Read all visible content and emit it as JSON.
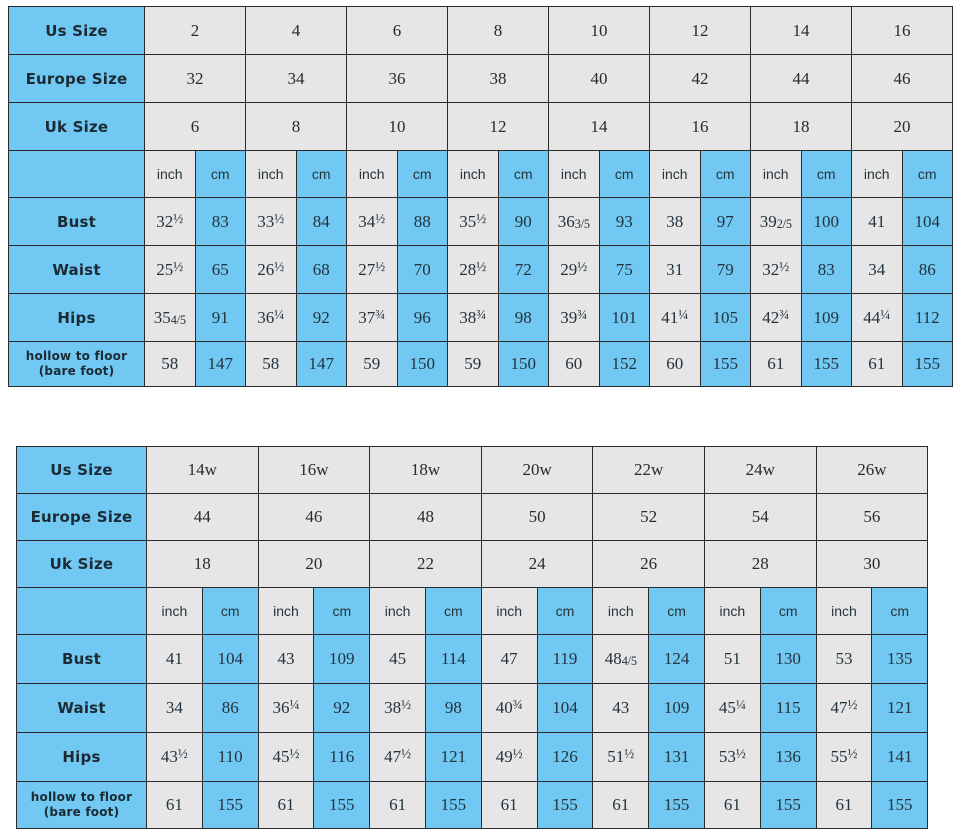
{
  "page": {
    "background": "#ffffff",
    "accent_blue": "#71c8f2",
    "cell_grey": "#e6e6e6",
    "border": "#2a2a2a"
  },
  "chart_data": [
    {
      "type": "table",
      "name": "standard-size-chart",
      "title": "",
      "row_labels": [
        "Us Size",
        "Europe Size",
        "Uk Size",
        "",
        "Bust",
        "Waist",
        "Hips",
        "hollow to floor\n(bare foot)"
      ],
      "unit_header": [
        "inch",
        "cm"
      ],
      "columns": [
        {
          "us": "2",
          "europe": "32",
          "uk": "6"
        },
        {
          "us": "4",
          "europe": "34",
          "uk": "8"
        },
        {
          "us": "6",
          "europe": "36",
          "uk": "10"
        },
        {
          "us": "8",
          "europe": "38",
          "uk": "12"
        },
        {
          "us": "10",
          "europe": "40",
          "uk": "14"
        },
        {
          "us": "12",
          "europe": "42",
          "uk": "16"
        },
        {
          "us": "14",
          "europe": "44",
          "uk": "18"
        },
        {
          "us": "16",
          "europe": "46",
          "uk": "20"
        }
      ],
      "rows": [
        {
          "label": "Bust",
          "inch": [
            "32 1/2",
            "33 1/2",
            "34 1/2",
            "35 1/2",
            "36 3/5",
            "38",
            "39 2/5",
            "41"
          ],
          "cm": [
            "83",
            "84",
            "88",
            "90",
            "93",
            "97",
            "100",
            "104"
          ]
        },
        {
          "label": "Waist",
          "inch": [
            "25 1/2",
            "26 1/2",
            "27 1/2",
            "28 1/2",
            "29 1/2",
            "31",
            "32 1/2",
            "34"
          ],
          "cm": [
            "65",
            "68",
            "70",
            "72",
            "75",
            "79",
            "83",
            "86"
          ]
        },
        {
          "label": "Hips",
          "inch": [
            "35 4/5",
            "36 1/4",
            "37 3/4",
            "38 3/4",
            "39 3/4",
            "41 1/4",
            "42 3/4",
            "44 1/4"
          ],
          "cm": [
            "91",
            "92",
            "96",
            "98",
            "101",
            "105",
            "109",
            "112"
          ]
        },
        {
          "label": "hollow to floor (bare foot)",
          "inch": [
            "58",
            "58",
            "59",
            "59",
            "60",
            "60",
            "61",
            "61"
          ],
          "cm": [
            "147",
            "147",
            "150",
            "150",
            "152",
            "155",
            "155",
            "155"
          ]
        }
      ]
    },
    {
      "type": "table",
      "name": "plus-size-chart",
      "title": "",
      "row_labels": [
        "Us Size",
        "Europe Size",
        "Uk Size",
        "",
        "Bust",
        "Waist",
        "Hips",
        "hollow to floor\n(bare foot)"
      ],
      "unit_header": [
        "inch",
        "cm"
      ],
      "columns": [
        {
          "us": "14w",
          "europe": "44",
          "uk": "18"
        },
        {
          "us": "16w",
          "europe": "46",
          "uk": "20"
        },
        {
          "us": "18w",
          "europe": "48",
          "uk": "22"
        },
        {
          "us": "20w",
          "europe": "50",
          "uk": "24"
        },
        {
          "us": "22w",
          "europe": "52",
          "uk": "26"
        },
        {
          "us": "24w",
          "europe": "54",
          "uk": "28"
        },
        {
          "us": "26w",
          "europe": "56",
          "uk": "30"
        }
      ],
      "rows": [
        {
          "label": "Bust",
          "inch": [
            "41",
            "43",
            "45",
            "47",
            "48 4/5",
            "51",
            "53"
          ],
          "cm": [
            "104",
            "109",
            "114",
            "119",
            "124",
            "130",
            "135"
          ]
        },
        {
          "label": "Waist",
          "inch": [
            "34",
            "36 1/4",
            "38 1/2",
            "40 3/4",
            "43",
            "45 1/4",
            "47 1/2"
          ],
          "cm": [
            "86",
            "92",
            "98",
            "104",
            "109",
            "115",
            "121"
          ]
        },
        {
          "label": "Hips",
          "inch": [
            "43 1/2",
            "45 1/2",
            "47 1/2",
            "49 1/2",
            "51 1/2",
            "53 1/2",
            "55 1/2"
          ],
          "cm": [
            "110",
            "116",
            "121",
            "126",
            "131",
            "136",
            "141"
          ]
        },
        {
          "label": "hollow to floor (bare foot)",
          "inch": [
            "61",
            "61",
            "61",
            "61",
            "61",
            "61",
            "61"
          ],
          "cm": [
            "155",
            "155",
            "155",
            "155",
            "155",
            "155",
            "155"
          ]
        }
      ]
    }
  ],
  "tables": [
    {
      "id": "standard",
      "label_column_header": "",
      "labels": {
        "us": "Us Size",
        "europe": "Europe Size",
        "uk": "Uk Size",
        "bust": "Bust",
        "waist": "Waist",
        "hips": "Hips",
        "hollow_line1": "hollow to floor",
        "hollow_line2": "(bare foot)"
      },
      "unit_inch": "inch",
      "unit_cm": "cm"
    },
    {
      "id": "plus",
      "label_column_header": "",
      "labels": {
        "us": "Us Size",
        "europe": "Europe Size",
        "uk": "Uk Size",
        "bust": "Bust",
        "waist": "Waist",
        "hips": "Hips",
        "hollow_line1": "hollow to floor",
        "hollow_line2": "(bare foot)"
      },
      "unit_inch": "inch",
      "unit_cm": "cm"
    }
  ]
}
